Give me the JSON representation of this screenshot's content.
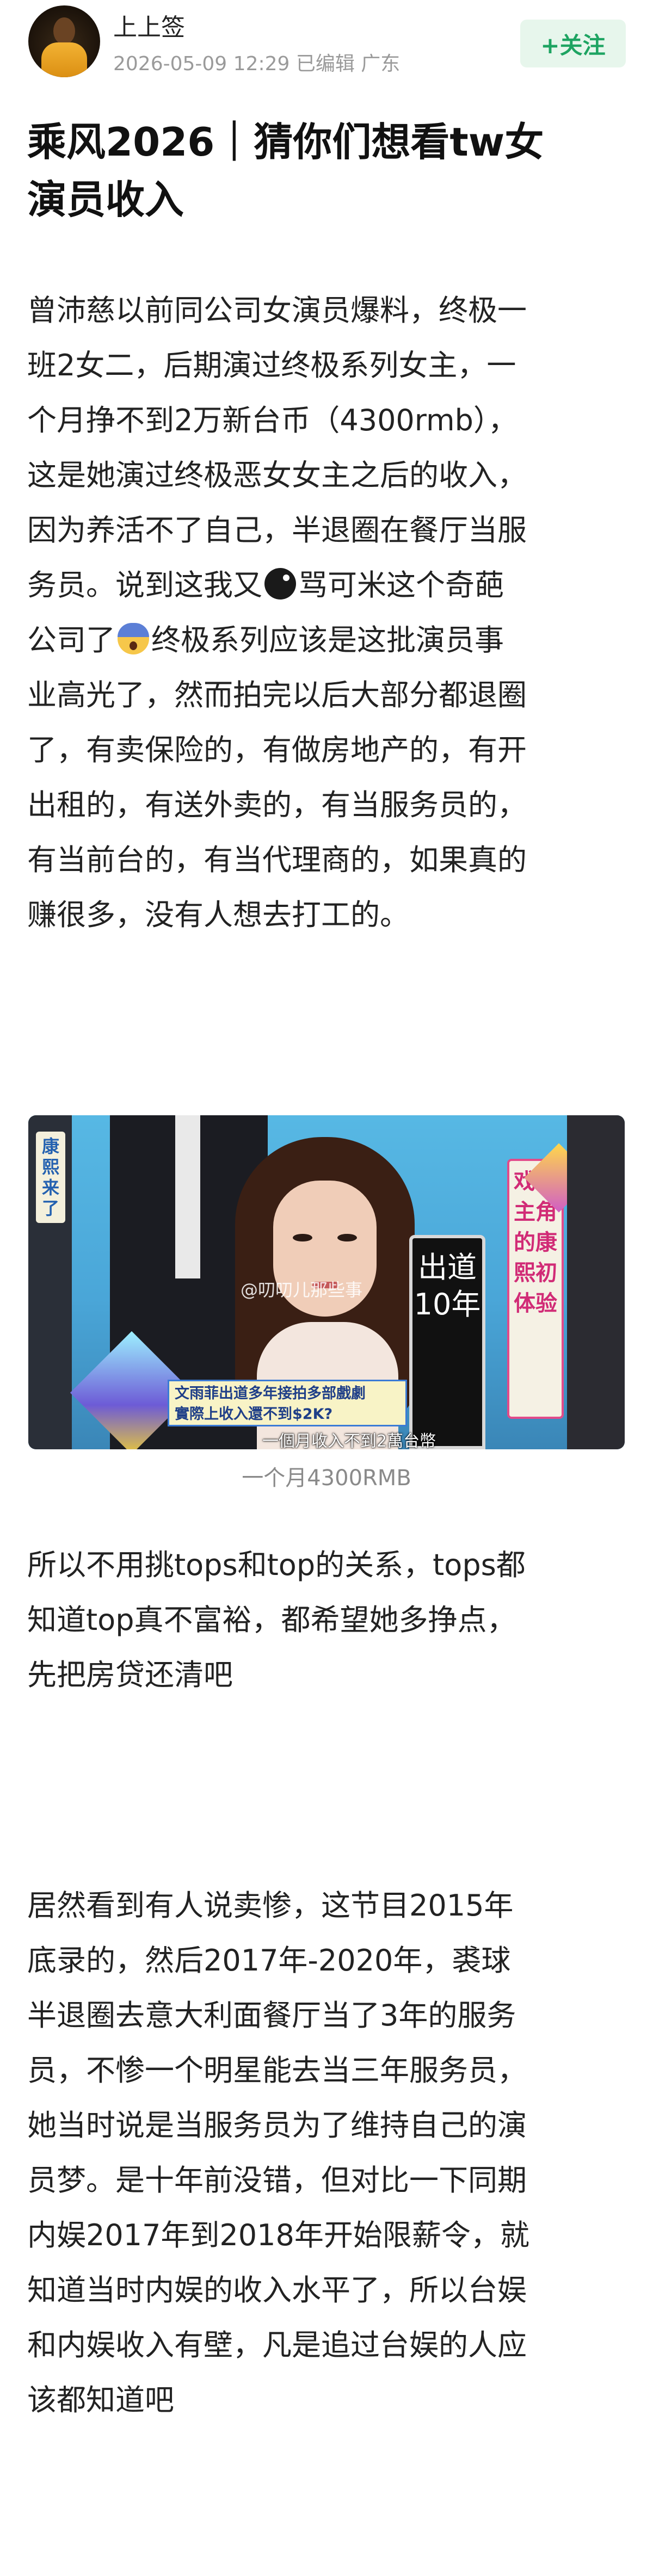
{
  "header": {
    "author_name": "上上签",
    "post_meta": "2026-05-09 12:29 已编辑 广东",
    "follow_label": "+关注"
  },
  "title_lines": [
    "乘风2026｜猜你们想看tw女",
    "演员收入"
  ],
  "paragraph1": {
    "lines": [
      "曾沛慈以前同公司女演员爆料，终极一",
      "班2女二，后期演过终极系列女主，一",
      "个月挣不到2万新台币（4300rmb），",
      "这是她演过终极恶女女主之后的收入，",
      "因为养活不了自己，半退圈在餐厅当服"
    ],
    "line6_before_emoji": "务员。说到这我又",
    "line6_after_emoji": "骂可米这个奇葩",
    "line7_before_emoji": "公司了",
    "line7_after_emoji": "终极系列应该是这批演员事",
    "tail_lines": [
      "业高光了，然而拍完以后大部分都退圈",
      "了，有卖保险的，有做房地产的，有开",
      "出租的，有送外卖的，有当服务员的，",
      "有当前台的，有当代理商的，如果真的",
      "赚很多，没有人想去打工的。"
    ]
  },
  "figure": {
    "left_vertical_label": "康熙来了",
    "board_text": "出道10年",
    "right_panel_text": "戏剧主角的康熙初体验",
    "watermark": "@叨叨儿那些事",
    "caption_bar_line1": "文雨菲出道多年接拍多部戲劇",
    "caption_bar_line2": "實際上收入還不到$2K?",
    "subtitle": "一個月收入不到2萬台幣",
    "caption": "一个月4300RMB"
  },
  "paragraph2": {
    "lines": [
      "所以不用挑tops和top的关系，tops都",
      "知道top真不富裕，都希望她多挣点，",
      "先把房贷还清吧"
    ]
  },
  "paragraph3": {
    "lines": [
      "居然看到有人说卖惨，这节目2015年",
      "底录的，然后2017年-2020年，裘球",
      "半退圈去意大利面餐厅当了3年的服务",
      "员，不惨一个明星能去当三年服务员，",
      "她当时说是当服务员为了维持自己的演",
      "员梦。是十年前没错，但对比一下同期",
      "内娱2017年到2018年开始限薪令，就",
      "知道当时内娱的收入水平了，所以台娱",
      "和内娱收入有壁，凡是追过台娱的人应",
      "该都知道吧"
    ]
  },
  "colors": {
    "follow_green": "#1ea462",
    "follow_bg": "#e7f6ec",
    "meta_gray": "#9a9a9a"
  },
  "icons": {
    "avatar": "avatar",
    "emoji1": "black-face-emoji-icon",
    "emoji2": "fearful-face-emoji-icon"
  }
}
